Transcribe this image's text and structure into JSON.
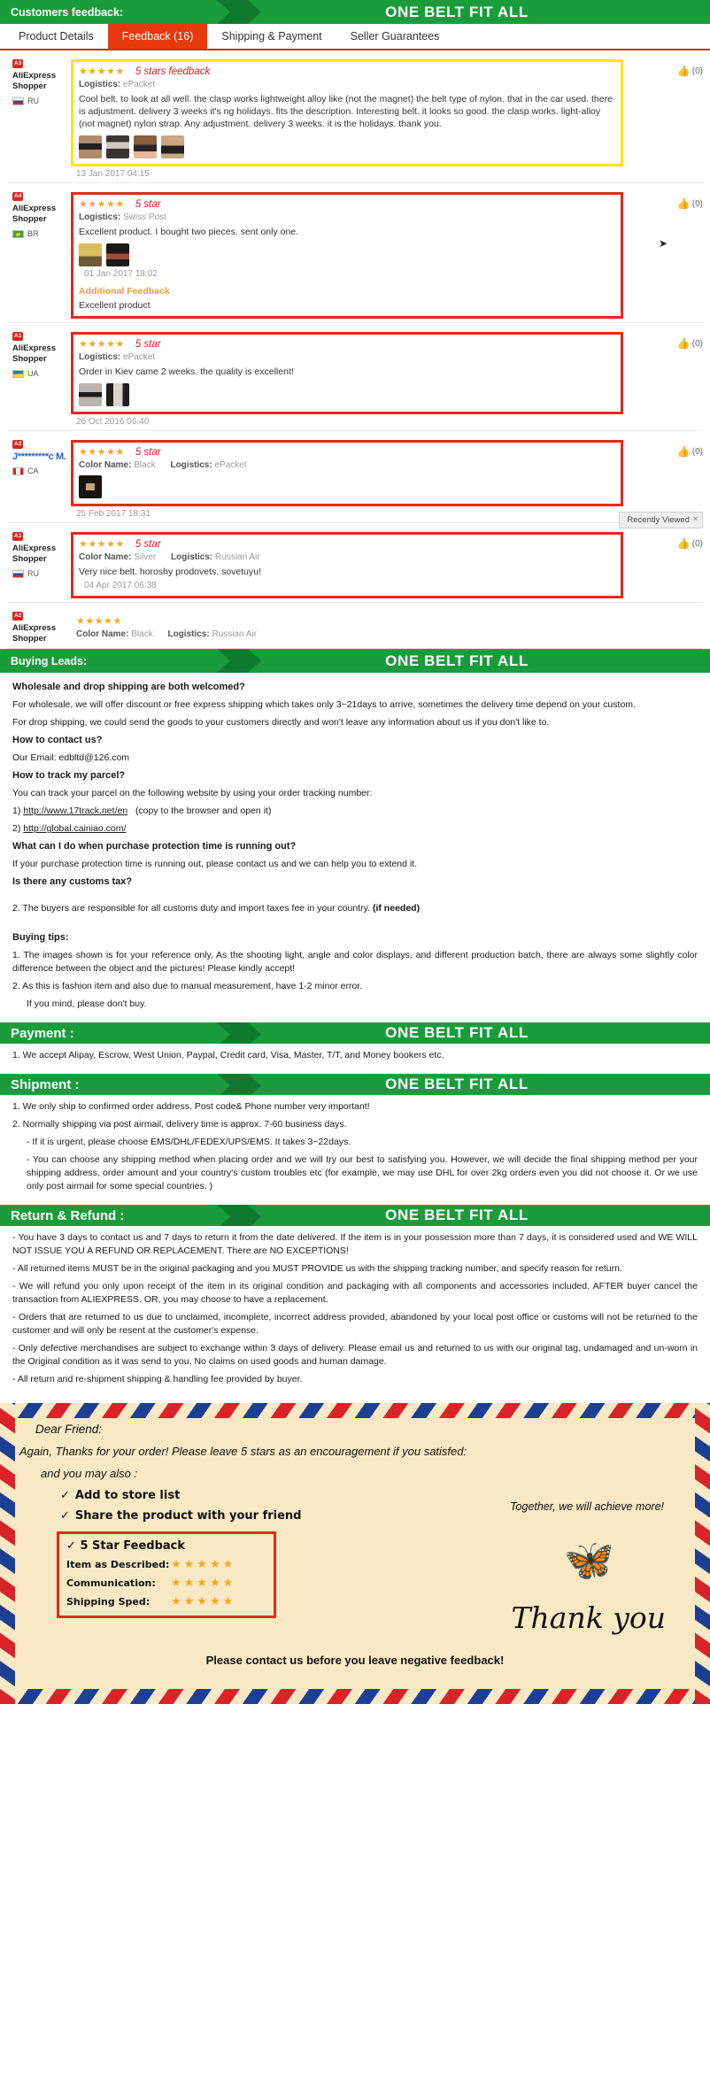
{
  "banners": {
    "feedback": {
      "left": "Customers feedback:",
      "right": "ONE BELT FIT ALL"
    },
    "buying": {
      "left": "Buying Leads:",
      "right": "ONE BELT FIT ALL"
    },
    "payment": {
      "left": "Payment :",
      "right": "ONE BELT FIT ALL"
    },
    "shipment": {
      "left": "Shipment :",
      "right": "ONE BELT FIT ALL"
    },
    "returns": {
      "left": "Return & Refund :",
      "right": "ONE BELT FIT ALL"
    }
  },
  "tabs": [
    {
      "label": "Product Details",
      "active": false
    },
    {
      "label": "Feedback (16)",
      "active": true
    },
    {
      "label": "Shipping & Payment",
      "active": false
    },
    {
      "label": "Seller Guarantees",
      "active": false
    }
  ],
  "overlays": {
    "recently_viewed": "Recently Viewed",
    "recently_viewed_close": "✕"
  },
  "feedback": [
    {
      "badge": "A3",
      "user_name": "AliExpress Shopper",
      "country": "RU",
      "stars": "★★★★★",
      "note": "5 stars feedback",
      "meta_label": "Logistics:",
      "meta_value": "ePacket",
      "color_label": "",
      "color_value": "",
      "text": "Cool belt. to look at all well. the clasp works lightweight alloy like (not the magnet) the belt type of nylon. that in the car used. there is adjustment. delivery 3 weeks it's ng holidays. fits the description. Interesting belt. it looks so good. the clasp works. light-alloy (not magnet) nylon strap. Any adjustment. delivery 3 weeks. it is the holidays. thank you.",
      "date": "13 Jan 2017 04:15",
      "helpful": "(0)",
      "thumbs": 4,
      "highlight": "yellow",
      "additional_title": "",
      "additional_text": ""
    },
    {
      "badge": "A4",
      "user_name": "AliExpress Shopper",
      "country": "BR",
      "stars": "★★★★★",
      "note": "5 star",
      "meta_label": "Logistics:",
      "meta_value": "Swiss Post",
      "color_label": "",
      "color_value": "",
      "text": "Excellent product. I bought two pieces. sent only one.",
      "date": "01 Jan 2017 18:02",
      "helpful": "(0)",
      "thumbs": 2,
      "highlight": "red",
      "additional_title": "Additional Feedback",
      "additional_text": "Excellent product"
    },
    {
      "badge": "A1",
      "user_name": "AliExpress Shopper",
      "country": "UA",
      "stars": "★★★★★",
      "note": "5 star",
      "meta_label": "Logistics:",
      "meta_value": "ePacket",
      "color_label": "",
      "color_value": "",
      "text": "Order in Kiev came 2 weeks. the quality is excellent!",
      "date": "26 Oct 2016 06:40",
      "helpful": "(0)",
      "thumbs": 2,
      "highlight": "red",
      "additional_title": "",
      "additional_text": ""
    },
    {
      "badge": "A2",
      "user_name": "J*********c M.",
      "country": "CA",
      "stars": "★★★★★",
      "note": "5 star",
      "meta_label": "Logistics:",
      "meta_value": "ePacket",
      "color_label": "Color Name:",
      "color_value": "Black",
      "text": "",
      "date": "25 Feb 2017 18:31",
      "helpful": "(0)",
      "thumbs": 1,
      "highlight": "red",
      "additional_title": "",
      "additional_text": ""
    },
    {
      "badge": "A1",
      "user_name": "AliExpress Shopper",
      "country": "RU",
      "stars": "★★★★★",
      "note": "5 star",
      "meta_label": "Logistics:",
      "meta_value": "Russian Air",
      "color_label": "Color Name:",
      "color_value": "Silver",
      "text": "Very nice belt. horoshy prodovets. sovetuyu!",
      "date": "04 Apr 2017 06:38",
      "helpful": "(0)",
      "thumbs": 0,
      "highlight": "red",
      "additional_title": "",
      "additional_text": ""
    },
    {
      "badge": "A2",
      "user_name": "AliExpress Shopper",
      "country": "",
      "stars": "★★★★★",
      "note": "",
      "meta_label": "Logistics:",
      "meta_value": "Russian Air",
      "color_label": "Color Name:",
      "color_value": "Black",
      "text": "",
      "date": "",
      "helpful": "",
      "thumbs": 0,
      "highlight": "none",
      "additional_title": "",
      "additional_text": ""
    }
  ],
  "buying_leads": {
    "q1": "Wholesale and drop shipping are both welcomed?",
    "p1": "For wholesale, we will offer discount or free express shipping which takes only 3~21days to arrive, sometimes the delivery time depend on your custom.",
    "p2": "For drop shipping, we could send the goods to your customers directly and won't leave any information about us if you don't like to.",
    "q2": "How to contact us?",
    "p3": "Our Email: edbltd@126.com",
    "q3": "How to track my parcel?",
    "p4": "You can track your parcel on the following website by using your order tracking number:",
    "link1_prefix": "1) ",
    "link1": "http://www.17track.net/en",
    "link1_suffix": "(copy to the browser and open it)",
    "link2_prefix": "2) ",
    "link2": "http://global.cainiao.com/",
    "q4": "What can I do when purchase protection time is running out?",
    "p5": "If your purchase protection time is running out, please contact us and we can help you to extend it.",
    "q5": "Is there any customs tax?",
    "p6": "2. The buyers are responsible for all customs duty and import taxes fee in your country.",
    "p6_bold": "(if needed)",
    "q6": "Buying tips:",
    "p7": "1. The images shown is for your reference only, As the shooting light, angle and color displays, and different production batch, there are always some slightly color difference between the object and the pictures! Please kindly accept!",
    "p8": "2. As this is fashion item and also due to manual measurement, have 1-2 minor error.",
    "p9": "If you mind, please don't buy."
  },
  "payment": {
    "p1": "1. We accept Alipay, Escrow, West Union, Paypal, Credit card, Visa, Master, T/T, and Money bookers etc."
  },
  "shipment": {
    "p1": "1. We only ship to confirmed order address. Post code& Phone number very important!",
    "p2": "2. Normally shipping via post airmail, delivery time is approx. 7-60 business days.",
    "p3": "- If it is urgent, please choose EMS/DHL/FEDEX/UPS/EMS. It takes 3~22days.",
    "p4": "- You can choose any shipping method when placing order and we will try our best to satisfying you. However, we will decide the final shipping method per your shipping address, order amount and your country's custom troubles etc (for example, we may use DHL for over 2kg orders even you did not choose it. Or we use only post airmail for some special countries. )"
  },
  "returns": {
    "p1": "- You have 3 days to contact us and 7 days to return it from the date delivered. If the item is in your possession more than 7 days, it is considered used and WE WILL NOT ISSUE YOU A REFUND OR REPLACEMENT. There are NO EXCEPTIONS!",
    "p2": "- All returned items MUST be in the original packaging and you MUST PROVIDE us with the shipping tracking number, and specify reason for return.",
    "p3": "- We will refund you only upon receipt of the item in its original condition and packaging with all components and accessories included. AFTER buyer cancel the transaction from ALIEXPRESS. OR, you may choose to have a replacement.",
    "p4": "- Orders that are returned to us due to unclaimed, incomplete, incorrect address provided, abandoned by your local post office or customs will not be returned to the customer and will only be resent at the customer's expense.",
    "p5": "- Only defective merchandises are subject to exchange within 3 days of delivery. Please email us and returned to us with our original tag, undamaged and un-worn in the Original condition as it was send to you. No claims on used goods and human damage.",
    "p6": "- All return and re-shipment shipping & handling fee provided by buyer."
  },
  "thankyou_card": {
    "dear": "Dear Friend:",
    "again": "Again, Thanks for your order! Please leave 5 stars as an encouragement if you satisfed:",
    "also": "and you may also :",
    "check1": "Add to store list",
    "check2": "Share the product with your friend",
    "check_mark": "✓",
    "rate_title": "5 Star Feedback",
    "rate_rows": [
      {
        "label": "Item as Described:",
        "stars": "★★★★★"
      },
      {
        "label": "Communication:",
        "stars": "★★★★★"
      },
      {
        "label": "Shipping Sped:",
        "stars": "★★★★★"
      }
    ],
    "together": "Together, we will achieve more!",
    "thankyou": "Thank you",
    "bottom": "Please contact us before you leave negative feedback!"
  }
}
